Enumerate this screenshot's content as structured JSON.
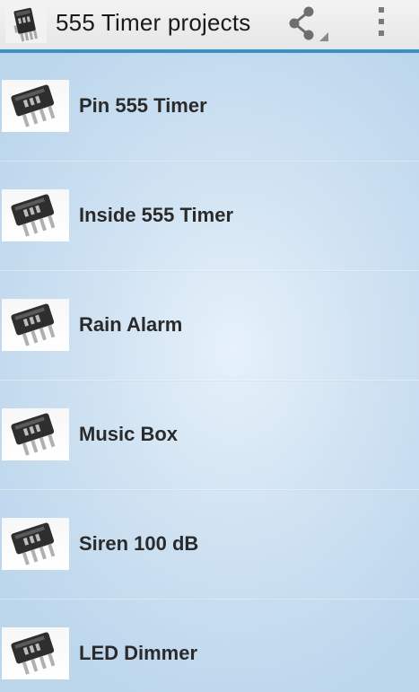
{
  "action_bar": {
    "title": "555 Timer projects",
    "app_icon": "ic555-chip-icon",
    "share_icon": "share-icon",
    "overflow_icon": "overflow-menu-icon"
  },
  "items": [
    {
      "label": "Pin 555 Timer",
      "icon": "ic555-chip-icon"
    },
    {
      "label": "Inside 555 Timer",
      "icon": "ic555-chip-icon"
    },
    {
      "label": "Rain Alarm",
      "icon": "ic555-chip-icon"
    },
    {
      "label": "Music Box",
      "icon": "ic555-chip-icon"
    },
    {
      "label": "Siren 100 dB",
      "icon": "ic555-chip-icon"
    },
    {
      "label": "LED Dimmer",
      "icon": "ic555-chip-icon"
    }
  ],
  "colors": {
    "accent_line": "#3a91c8",
    "list_background": "#cfe2f2",
    "text": "#2a2a2a"
  }
}
